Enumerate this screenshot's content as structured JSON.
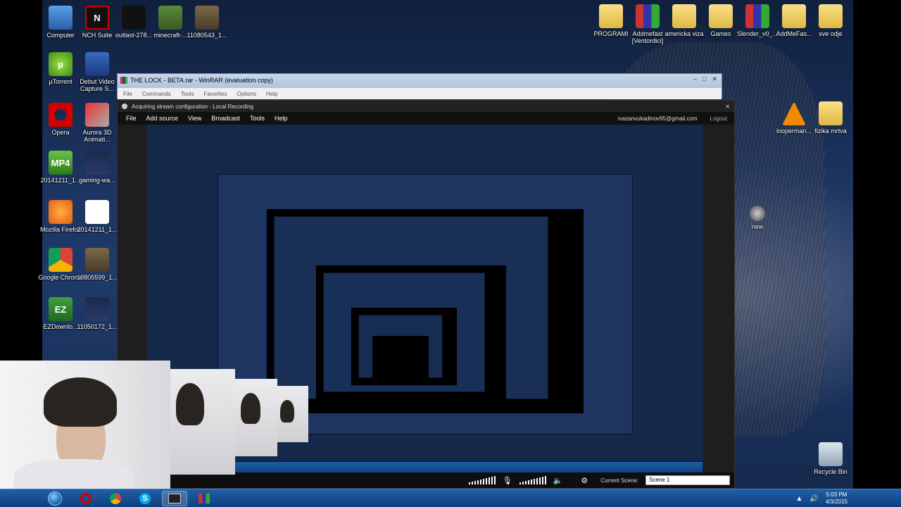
{
  "desktop": {
    "icons_left": [
      {
        "label": "Computer",
        "icon": "computer-icon"
      },
      {
        "label": "NCH Suite",
        "icon": "nch-suite-icon"
      },
      {
        "label": "outlast-278...",
        "icon": "video-file-icon"
      },
      {
        "label": "minecraft-...",
        "icon": "image-file-icon"
      },
      {
        "label": "11080543_1...",
        "icon": "image-file-icon"
      },
      {
        "label": "µTorrent",
        "icon": "utorrent-icon"
      },
      {
        "label": "Debut Video Capture S...",
        "icon": "debut-video-icon"
      },
      {
        "label": "Opera",
        "icon": "opera-icon"
      },
      {
        "label": "Aurora 3D Animati...",
        "icon": "aurora-3d-icon"
      },
      {
        "label": "20141211_1...",
        "icon": "mp4-file-icon"
      },
      {
        "label": "gaming-wa...",
        "icon": "image-file-icon"
      },
      {
        "label": "Mozilla Firefox",
        "icon": "firefox-icon"
      },
      {
        "label": "20141211_1...",
        "icon": "blank-file-icon"
      },
      {
        "label": "Google Chrome",
        "icon": "chrome-icon"
      },
      {
        "label": "10805599_1...",
        "icon": "image-file-icon"
      },
      {
        "label": "EZDownlo...",
        "icon": "ezdownloader-icon"
      },
      {
        "label": "11050172_1...",
        "icon": "image-file-icon"
      }
    ],
    "icons_right": [
      {
        "label": "PROGRAMI",
        "icon": "folder-icon"
      },
      {
        "label": "Addmefast [Ventordici]",
        "icon": "winrar-archive-icon"
      },
      {
        "label": "americka viza",
        "icon": "folder-icon"
      },
      {
        "label": "Games",
        "icon": "folder-icon"
      },
      {
        "label": "Slender_v0_...",
        "icon": "winrar-archive-icon"
      },
      {
        "label": "AddMeFas...",
        "icon": "folder-icon"
      },
      {
        "label": "sve odje",
        "icon": "folder-icon"
      },
      {
        "label": "looperman...",
        "icon": "vlc-icon"
      },
      {
        "label": "fizika mrtva",
        "icon": "folder-icon"
      },
      {
        "label": "new",
        "icon": "disc-icon"
      },
      {
        "label": "Recycle Bin",
        "icon": "recycle-bin-icon"
      }
    ]
  },
  "winrar": {
    "title": "THE LOCK - BETA.rar - WinRAR (evaluation copy)",
    "menu": [
      "File",
      "Commands",
      "Tools",
      "Favorites",
      "Options",
      "Help"
    ]
  },
  "obs": {
    "title": "Acquiring stream configuration - Local Recording",
    "menu": [
      "File",
      "Add source",
      "View",
      "Broadcast",
      "Tools",
      "Help"
    ],
    "account": "ivazanvukadinov95@gmail.com",
    "logout": "Logout",
    "current_scene_label": "Current Scene:",
    "current_scene_value": "Scene 1"
  },
  "taskbar": {
    "apps": [
      "start",
      "opera",
      "chrome",
      "skype",
      "obs",
      "winrar"
    ],
    "active": "obs",
    "time": "5:03 PM",
    "date": "4/3/2015"
  },
  "colors": {
    "taskbar": "#1f5fa8",
    "obs_bg": "#1e1e1e",
    "desktop_bg": "#1c3460"
  }
}
